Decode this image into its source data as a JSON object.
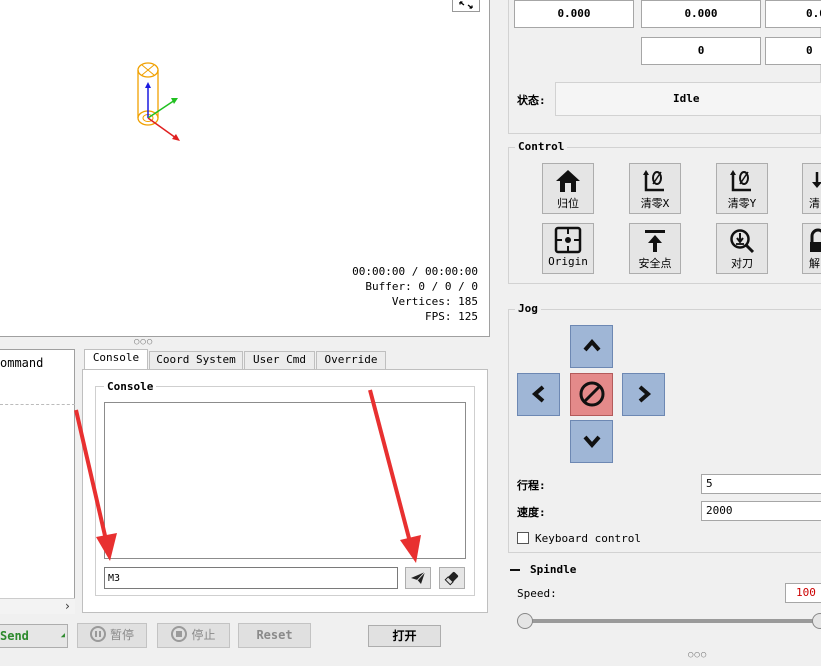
{
  "viewport": {
    "time": "00:00:00 / 00:00:00",
    "buffer": "Buffer: 0 / 0 / 0",
    "vertices": "Vertices: 185",
    "fps": "FPS: 125"
  },
  "program": {
    "header": "ommand",
    "scroll_right": "›"
  },
  "tabs": [
    {
      "label": "Console",
      "active": true
    },
    {
      "label": "Coord System",
      "active": false
    },
    {
      "label": "User Cmd",
      "active": false
    },
    {
      "label": "Override",
      "active": false
    }
  ],
  "console": {
    "group_title": "Console",
    "command_value": "M3"
  },
  "buttons": {
    "send": "Send",
    "pause": "暂停",
    "stop": "停止",
    "reset": "Reset",
    "open": "打开"
  },
  "coords": {
    "row1": [
      "0.000",
      "0.000",
      "0.0"
    ],
    "row2": [
      "0",
      "0"
    ]
  },
  "state": {
    "label": "状态:",
    "value": "Idle"
  },
  "control": {
    "title": "Control",
    "buttons": [
      {
        "label": "归位",
        "icon": "home-icon"
      },
      {
        "label": "清零X",
        "icon": "zero-x-icon"
      },
      {
        "label": "清零Y",
        "icon": "zero-y-icon"
      },
      {
        "label": "清",
        "icon": "zero-z-icon"
      },
      {
        "label": "Origin",
        "icon": "origin-icon"
      },
      {
        "label": "安全点",
        "icon": "safe-position-icon"
      },
      {
        "label": "对刀",
        "icon": "probe-icon"
      },
      {
        "label": "解",
        "icon": "unlock-icon"
      }
    ]
  },
  "jog": {
    "title": "Jog",
    "travel_label": "行程:",
    "travel_value": "5",
    "speed_label": "速度:",
    "speed_value": "2000",
    "keyboard_label": "Keyboard control"
  },
  "spindle": {
    "title": "Spindle",
    "speed_label": "Speed:",
    "speed_value": "100"
  },
  "colors": {
    "jog_button": "#9fb6d6",
    "stop_button": "#e48a8a",
    "send_text": "#2d8a2d",
    "annotation_arrow": "#e83030",
    "tool_model": "#f0a000"
  }
}
